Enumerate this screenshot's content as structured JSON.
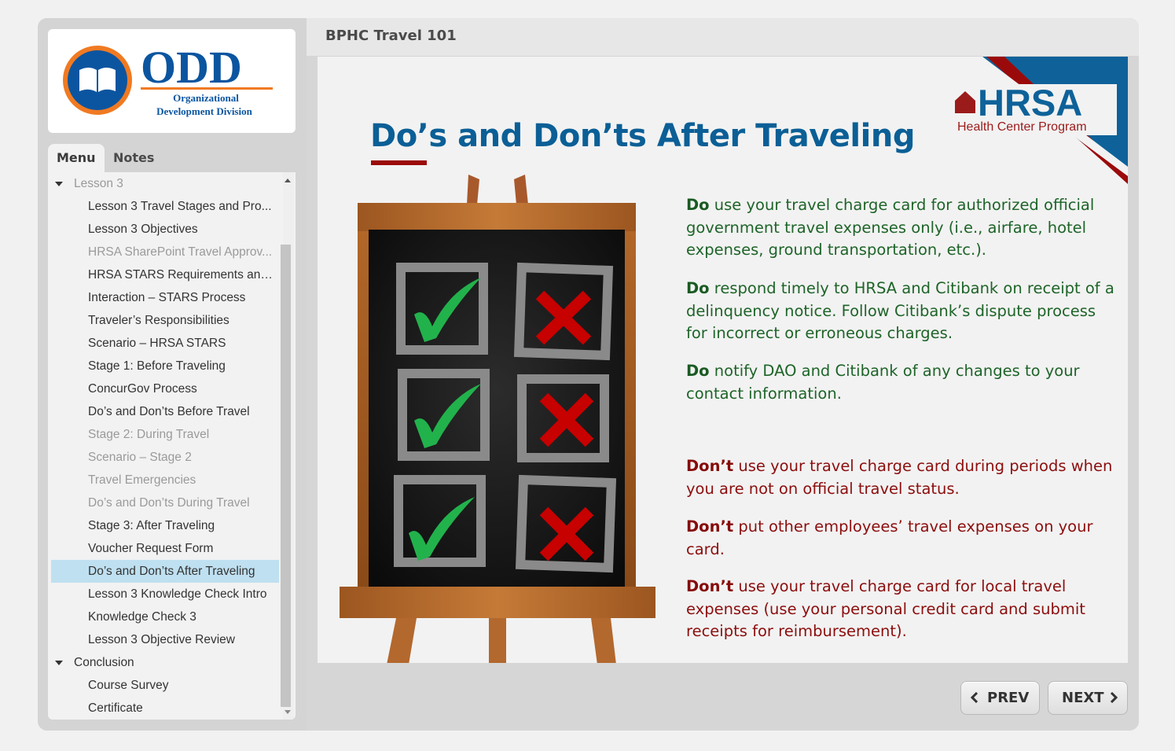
{
  "course": {
    "title": "BPHC Travel 101"
  },
  "logo": {
    "name": "ODD",
    "line1": "Organizational",
    "line2": "Development Division",
    "brand_blue": "#0b55a0",
    "brand_orange": "#f07a22"
  },
  "sidebar": {
    "tabs": [
      {
        "label": "Menu",
        "active": true
      },
      {
        "label": "Notes",
        "active": false
      }
    ],
    "menu": [
      {
        "label": "Lesson 3",
        "type": "section",
        "state": "dim"
      },
      {
        "label": "Lesson 3 Travel Stages and Pro...",
        "state": "visited"
      },
      {
        "label": "Lesson 3 Objectives",
        "state": "visited"
      },
      {
        "label": "HRSA SharePoint Travel Approv...",
        "state": "dim"
      },
      {
        "label": "HRSA STARS Requirements and...",
        "state": "visited"
      },
      {
        "label": "Interaction – STARS Process",
        "state": "visited"
      },
      {
        "label": "Traveler’s Responsibilities",
        "state": "visited"
      },
      {
        "label": "Scenario – HRSA STARS",
        "state": "visited"
      },
      {
        "label": "Stage 1: Before Traveling",
        "state": "visited"
      },
      {
        "label": "ConcurGov Process",
        "state": "visited"
      },
      {
        "label": "Do’s and Don’ts Before Travel",
        "state": "visited"
      },
      {
        "label": "Stage 2: During Travel",
        "state": "dim"
      },
      {
        "label": "Scenario – Stage 2",
        "state": "dim"
      },
      {
        "label": "Travel Emergencies",
        "state": "dim"
      },
      {
        "label": "Do’s and Don’ts During Travel",
        "state": "dim"
      },
      {
        "label": "Stage 3: After Traveling",
        "state": "visited"
      },
      {
        "label": "Voucher Request Form",
        "state": "visited"
      },
      {
        "label": "Do’s and Don’ts After Traveling",
        "state": "selected"
      },
      {
        "label": "Lesson 3 Knowledge Check Intro",
        "state": "visited"
      },
      {
        "label": "Knowledge Check 3",
        "state": "visited"
      },
      {
        "label": "Lesson 3 Objective Review",
        "state": "visited"
      },
      {
        "label": "Conclusion",
        "type": "section",
        "state": "visited"
      },
      {
        "label": "Course Survey",
        "state": "visited"
      },
      {
        "label": "Certificate",
        "state": "visited"
      }
    ]
  },
  "slide": {
    "title": "Do’s and Don’ts After Traveling",
    "hrsa_logo": {
      "name": "HRSA",
      "tagline": "Health Center Program"
    },
    "dos": [
      {
        "lead": "Do",
        "text": " use your travel charge card for authorized official government travel expenses only (i.e., airfare, hotel expenses, ground transportation, etc.)."
      },
      {
        "lead": "Do",
        "text": " respond timely to HRSA and Citibank on receipt of a delinquency notice. Follow Citibank’s dispute process for incorrect or erroneous charges."
      },
      {
        "lead": "Do",
        "text": " notify DAO and Citibank of any changes to your contact information."
      }
    ],
    "donts": [
      {
        "lead": "Don’t",
        "text": " use your travel charge card during periods when you are not on official travel status."
      },
      {
        "lead": "Don’t",
        "text": " put other employees’ travel expenses on your card."
      },
      {
        "lead": "Don’t",
        "text": " use your travel charge card for local travel expenses (use your personal credit card and submit receipts for reimbursement)."
      }
    ],
    "colors": {
      "title": "#0b5f96",
      "do": "#1e6428",
      "dont": "#8c0e0e",
      "accent": "#9b0a0a"
    }
  },
  "nav": {
    "prev_label": "PREV",
    "next_label": "NEXT"
  }
}
